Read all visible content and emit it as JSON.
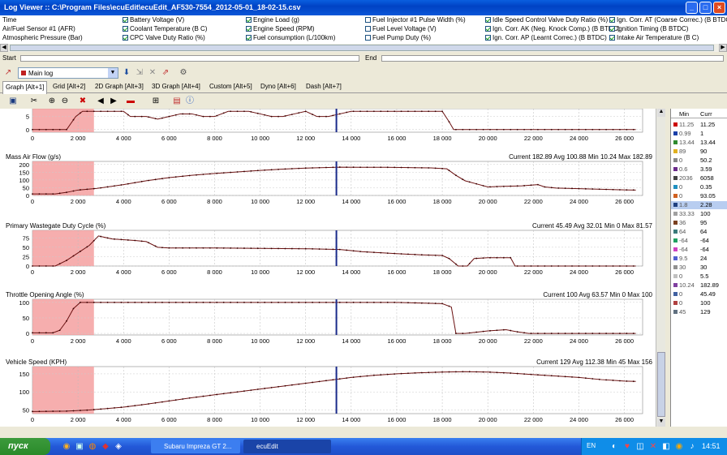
{
  "window": {
    "title": "Log Viewer :: C:\\Program Files\\ecuEdit\\ecuEdit_AF530-7554_2012-05-01_18-02-15.csv",
    "min": "_",
    "max": "□",
    "close": "×"
  },
  "params": [
    {
      "label": "Time",
      "checked": false
    },
    {
      "label": "Air/Fuel Sensor #1 (AFR)",
      "checked": false
    },
    {
      "label": "Atmospheric Pressure (Bar)",
      "checked": false
    },
    {
      "label": "Battery Voltage (V)",
      "checked": true
    },
    {
      "label": "Coolant Temperature (B C)",
      "checked": true
    },
    {
      "label": "CPC Valve Duty Ratio (%)",
      "checked": true
    },
    {
      "label": "Engine Load (g)",
      "checked": true
    },
    {
      "label": "Engine Speed (RPM)",
      "checked": true
    },
    {
      "label": "Fuel consumption (L/100km)",
      "checked": true
    },
    {
      "label": "Fuel Injector #1 Pulse Width (%)",
      "checked": false
    },
    {
      "label": "Fuel Level Voltage (V)",
      "checked": false
    },
    {
      "label": "Fuel Pump Duty (%)",
      "checked": false
    },
    {
      "label": "Idle Speed Control Valve Duty Ratio (%)",
      "checked": true
    },
    {
      "label": "Ign. Corr. AK (Neg. Knock Comp.) (B BTDC)",
      "checked": true
    },
    {
      "label": "Ign. Corr. AP (Learnt Correc.) (B BTDC)",
      "checked": true
    },
    {
      "label": "Ign. Corr. AT (Coarse Correc.) (B BTDC)",
      "checked": true
    },
    {
      "label": "Ignition Timing (B BTDC)",
      "checked": true
    },
    {
      "label": "Intake Air Temperature (B C)",
      "checked": true
    }
  ],
  "range": {
    "start_label": "Start",
    "end_label": "End"
  },
  "toolbar1": {
    "log_select": "Main log"
  },
  "tabs": [
    "Graph [Alt+1]",
    "Grid [Alt+2]",
    "2D Graph [Alt+3]",
    "3D Graph [Alt+4]",
    "Custom [Alt+5]",
    "Dyno [Alt+6]",
    "Dash [Alt+7]"
  ],
  "charts": [
    {
      "title": "",
      "stats": "",
      "yticks": [
        "5",
        "0"
      ],
      "ymin": -1,
      "ymax": 8,
      "points": [
        [
          0,
          0
        ],
        [
          1500,
          0
        ],
        [
          1900,
          5
        ],
        [
          2200,
          7
        ],
        [
          2600,
          7
        ],
        [
          3000,
          7
        ],
        [
          3500,
          7
        ],
        [
          4000,
          7
        ],
        [
          4300,
          5
        ],
        [
          5000,
          5
        ],
        [
          5500,
          4
        ],
        [
          6000,
          5
        ],
        [
          6500,
          6
        ],
        [
          7000,
          6
        ],
        [
          7500,
          5
        ],
        [
          8000,
          5
        ],
        [
          8600,
          7
        ],
        [
          9000,
          7
        ],
        [
          9500,
          7
        ],
        [
          10000,
          6
        ],
        [
          10500,
          5
        ],
        [
          11000,
          5
        ],
        [
          11500,
          6
        ],
        [
          12000,
          7
        ],
        [
          12500,
          5
        ],
        [
          13000,
          5
        ],
        [
          13500,
          6
        ],
        [
          14000,
          7
        ],
        [
          15000,
          7
        ],
        [
          16000,
          7
        ],
        [
          17000,
          7
        ],
        [
          17500,
          7
        ],
        [
          18000,
          7
        ],
        [
          18300,
          3
        ],
        [
          18500,
          0
        ],
        [
          19000,
          0
        ],
        [
          26500,
          0
        ]
      ]
    },
    {
      "title": "Mass Air Flow (g/s)",
      "stats": "Current 182.89 Avg 100.88 Min 10.24 Max 182.89",
      "yticks": [
        "200",
        "150",
        "100",
        "50",
        "0"
      ],
      "ymin": 0,
      "ymax": 220,
      "points": [
        [
          0,
          10
        ],
        [
          1000,
          10
        ],
        [
          1500,
          20
        ],
        [
          2000,
          35
        ],
        [
          2800,
          45
        ],
        [
          4000,
          70
        ],
        [
          5000,
          95
        ],
        [
          6000,
          115
        ],
        [
          7000,
          130
        ],
        [
          8000,
          142
        ],
        [
          9000,
          152
        ],
        [
          10000,
          162
        ],
        [
          11000,
          170
        ],
        [
          12000,
          177
        ],
        [
          13000,
          181
        ],
        [
          13500,
          183
        ],
        [
          14500,
          182
        ],
        [
          15500,
          182
        ],
        [
          16500,
          180
        ],
        [
          17500,
          178
        ],
        [
          18200,
          172
        ],
        [
          18600,
          130
        ],
        [
          19000,
          95
        ],
        [
          19500,
          75
        ],
        [
          20000,
          55
        ],
        [
          20500,
          58
        ],
        [
          21000,
          60
        ],
        [
          21500,
          62
        ],
        [
          22200,
          70
        ],
        [
          22500,
          55
        ],
        [
          23000,
          48
        ],
        [
          24000,
          44
        ],
        [
          25000,
          40
        ],
        [
          26000,
          36
        ],
        [
          26500,
          35
        ]
      ]
    },
    {
      "title": "Primary Wastegate Duty Cycle (%)",
      "stats": "Current 45.49 Avg 32.01 Min 0 Max 81.57",
      "yticks": [
        "75",
        "50",
        "25",
        "0"
      ],
      "ymin": 0,
      "ymax": 95,
      "points": [
        [
          0,
          0
        ],
        [
          1000,
          0
        ],
        [
          1500,
          15
        ],
        [
          2000,
          35
        ],
        [
          2500,
          55
        ],
        [
          2900,
          80
        ],
        [
          3500,
          72
        ],
        [
          4500,
          68
        ],
        [
          5000,
          65
        ],
        [
          5500,
          50
        ],
        [
          6000,
          48
        ],
        [
          8000,
          48
        ],
        [
          10000,
          47
        ],
        [
          12000,
          46
        ],
        [
          13500,
          44
        ],
        [
          14500,
          38
        ],
        [
          16000,
          33
        ],
        [
          17000,
          30
        ],
        [
          18000,
          28
        ],
        [
          18300,
          20
        ],
        [
          18700,
          0
        ],
        [
          19100,
          0
        ],
        [
          19400,
          20
        ],
        [
          20000,
          22
        ],
        [
          21000,
          22
        ],
        [
          21200,
          0
        ],
        [
          22000,
          0
        ],
        [
          26500,
          0
        ]
      ]
    },
    {
      "title": "Throttle Opening Angle (%)",
      "stats": "Current 100 Avg 63.57 Min 0 Max 100",
      "yticks": [
        "100",
        "50",
        "0"
      ],
      "ymin": -5,
      "ymax": 110,
      "points": [
        [
          0,
          2
        ],
        [
          900,
          2
        ],
        [
          1200,
          10
        ],
        [
          1500,
          40
        ],
        [
          1800,
          80
        ],
        [
          2100,
          100
        ],
        [
          3000,
          100
        ],
        [
          6000,
          100
        ],
        [
          10000,
          100
        ],
        [
          13500,
          100
        ],
        [
          15000,
          100
        ],
        [
          16000,
          100
        ],
        [
          17000,
          98
        ],
        [
          18000,
          96
        ],
        [
          18400,
          85
        ],
        [
          18600,
          0
        ],
        [
          19000,
          0
        ],
        [
          20000,
          8
        ],
        [
          20800,
          12
        ],
        [
          21300,
          5
        ],
        [
          21800,
          0
        ],
        [
          26500,
          0
        ]
      ]
    },
    {
      "title": "Vehicle Speed (KPH)",
      "stats": "Current 129 Avg 112.38 Min 45 Max 156",
      "yticks": [
        "150",
        "100",
        "50"
      ],
      "ymin": 40,
      "ymax": 170,
      "points": [
        [
          0,
          46
        ],
        [
          1500,
          47
        ],
        [
          2500,
          50
        ],
        [
          4000,
          58
        ],
        [
          5000,
          66
        ],
        [
          6000,
          75
        ],
        [
          7000,
          84
        ],
        [
          8000,
          92
        ],
        [
          9000,
          100
        ],
        [
          10000,
          108
        ],
        [
          11000,
          116
        ],
        [
          12000,
          124
        ],
        [
          13000,
          132
        ],
        [
          14000,
          140
        ],
        [
          15000,
          146
        ],
        [
          16000,
          150
        ],
        [
          17000,
          153
        ],
        [
          18000,
          155
        ],
        [
          19000,
          156
        ],
        [
          20000,
          155
        ],
        [
          21000,
          152
        ],
        [
          22000,
          148
        ],
        [
          23000,
          144
        ],
        [
          24000,
          140
        ],
        [
          25000,
          134
        ],
        [
          26000,
          130
        ],
        [
          26500,
          129
        ]
      ]
    }
  ],
  "xticks": [
    "0",
    "2 000",
    "4 000",
    "6 000",
    "8 000",
    "10 000",
    "12 000",
    "14 000",
    "16 000",
    "18 000",
    "20 000",
    "22 000",
    "24 000",
    "26 000"
  ],
  "legend": {
    "head_min": "Min",
    "head_cur": "Curr",
    "rows": [
      {
        "color": "#cc0000",
        "min": "11.25",
        "cur": "11.25"
      },
      {
        "color": "#1a3fa8",
        "min": "0.99",
        "cur": "1"
      },
      {
        "color": "#2e8b2e",
        "min": "13.44",
        "cur": "13.44"
      },
      {
        "color": "#e0b020",
        "min": "89",
        "cur": "90"
      },
      {
        "color": "#888888",
        "min": "0",
        "cur": "50.2"
      },
      {
        "color": "#6a2a8a",
        "min": "0.6",
        "cur": "3.59"
      },
      {
        "color": "#444444",
        "min": "2036",
        "cur": "6058"
      },
      {
        "color": "#2090c0",
        "min": "0",
        "cur": "0.35"
      },
      {
        "color": "#d06020",
        "min": "0",
        "cur": "93.05"
      },
      {
        "color": "#204080",
        "min": "1.8",
        "cur": "2.28"
      },
      {
        "color": "#a0a0a0",
        "min": "33.33",
        "cur": "100"
      },
      {
        "color": "#7a4020",
        "min": "36",
        "cur": "95"
      },
      {
        "color": "#3a7a7a",
        "min": "64",
        "cur": "64"
      },
      {
        "color": "#20a060",
        "min": "-64",
        "cur": "-64"
      },
      {
        "color": "#d040c0",
        "min": "-64",
        "cur": "-64"
      },
      {
        "color": "#5060d0",
        "min": "9.5",
        "cur": "24"
      },
      {
        "color": "#909090",
        "min": "30",
        "cur": "30"
      },
      {
        "color": "#c0c0c0",
        "min": "0",
        "cur": "5.5"
      },
      {
        "color": "#8040a0",
        "min": "10.24",
        "cur": "182.89"
      },
      {
        "color": "#4060a0",
        "min": "0",
        "cur": "45.49"
      },
      {
        "color": "#b04040",
        "min": "0",
        "cur": "100"
      },
      {
        "color": "#607080",
        "min": "45",
        "cur": "129"
      }
    ]
  },
  "taskbar": {
    "start": "пуск",
    "task1": "Subaru Impreza GT 2...",
    "task2": "ecuEdit",
    "lang": "EN",
    "clock": "14:51"
  }
}
